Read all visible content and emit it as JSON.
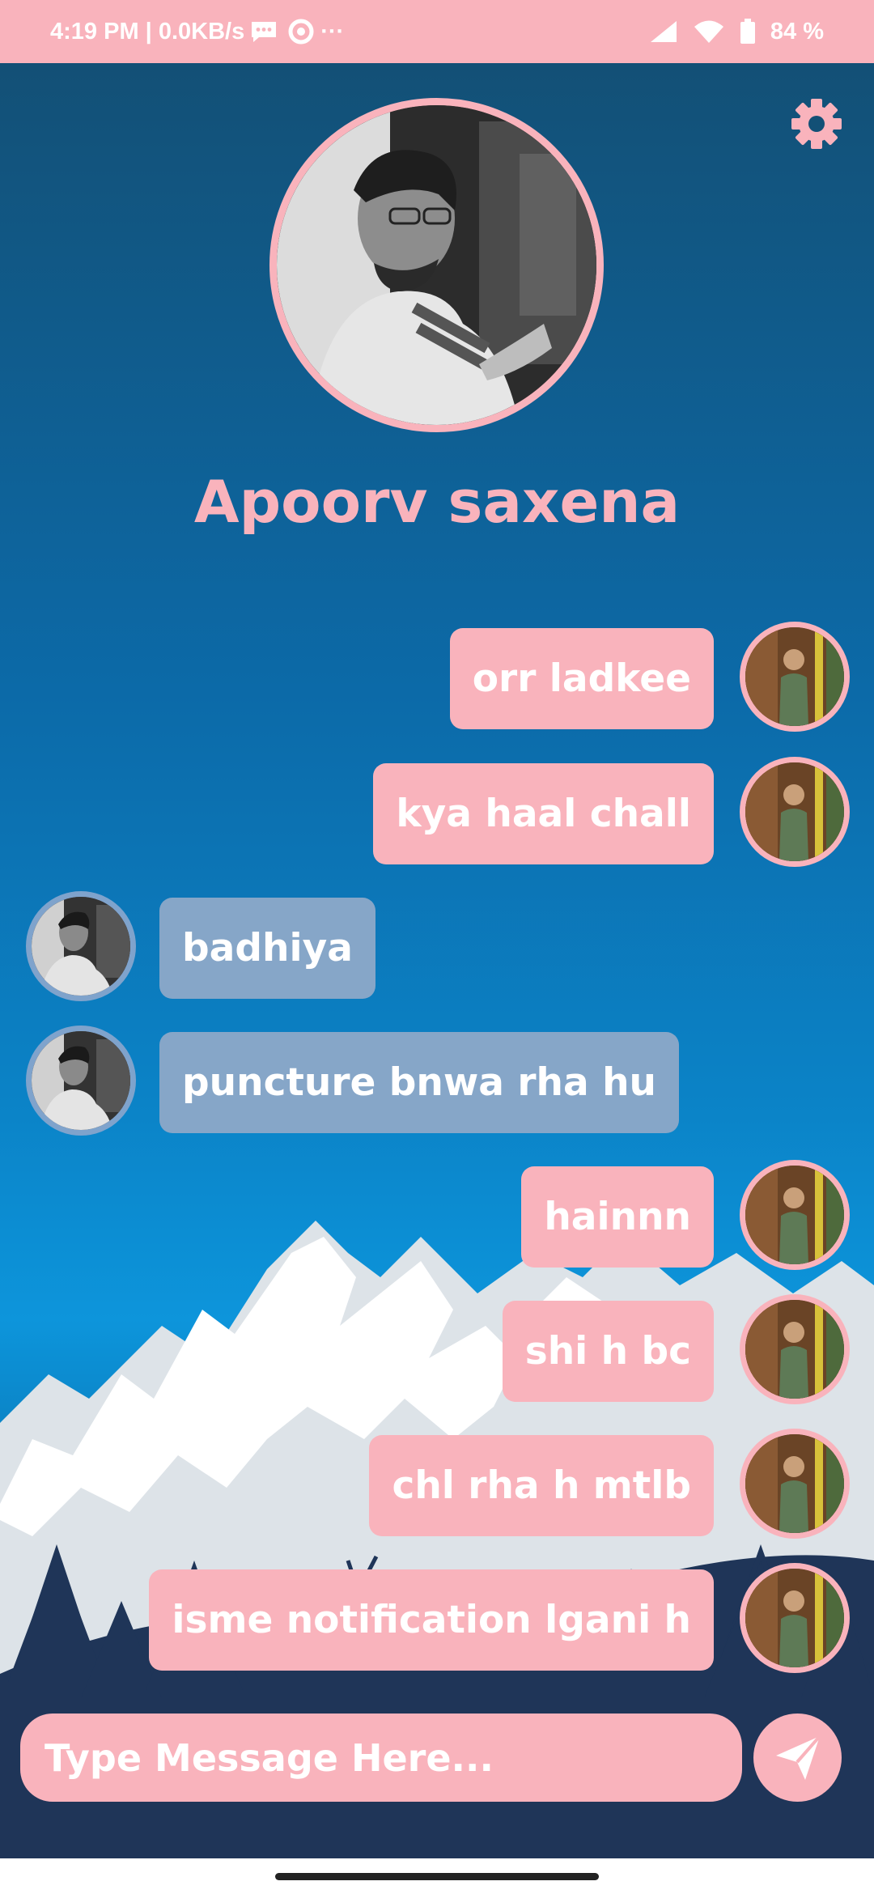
{
  "status_bar": {
    "time_info": "4:19 PM | 0.0KB/s",
    "more_indicator": "···",
    "battery": "84 %"
  },
  "profile": {
    "name": "Apoorv saxena"
  },
  "messages": [
    {
      "direction": "sent",
      "text": "orr ladkee"
    },
    {
      "direction": "sent",
      "text": "kya haal chall"
    },
    {
      "direction": "received",
      "text": "badhiya"
    },
    {
      "direction": "received",
      "text": "puncture bnwa rha hu"
    },
    {
      "direction": "sent",
      "text": "hainnn"
    },
    {
      "direction": "sent",
      "text": "shi h bc"
    },
    {
      "direction": "sent",
      "text": "chl rha h mtlb"
    },
    {
      "direction": "sent",
      "text": "isme notification lgani h"
    }
  ],
  "composer": {
    "placeholder": "Type Message Here..."
  },
  "icons": {
    "settings": "gear-icon",
    "send": "paper-plane-icon",
    "status": [
      "message-notification-icon",
      "circle-notification-icon",
      "signal-icon",
      "wifi-icon",
      "battery-icon"
    ]
  },
  "colors": {
    "accent_pink": "#f9b3bc",
    "received_bubble": "#86a6c8",
    "sky_top": "#135076",
    "sky_bottom": "#0d95db",
    "ground": "#1f3558"
  }
}
